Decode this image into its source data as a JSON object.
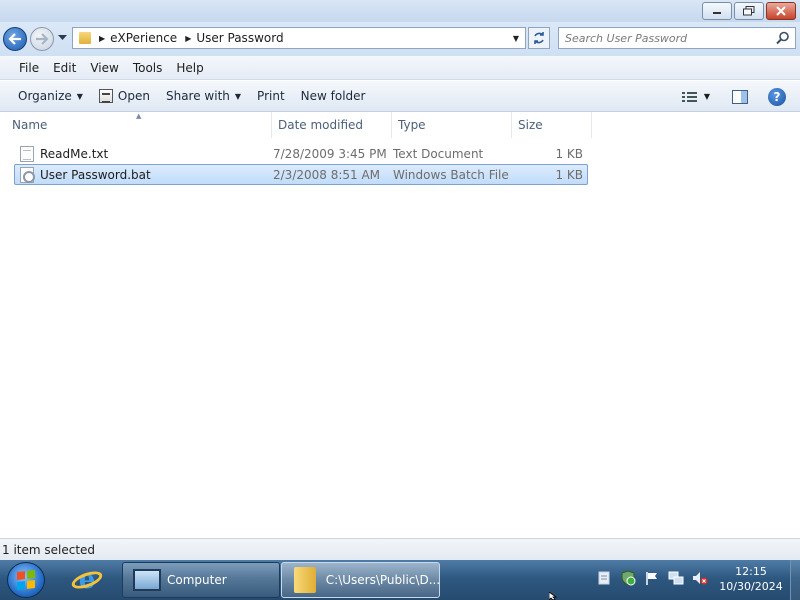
{
  "window": {
    "buttons": {
      "minimize": "minimize",
      "maximize": "maximize",
      "close": "close"
    }
  },
  "address": {
    "crumbs": [
      "eXPerience",
      "User Password"
    ],
    "search_placeholder": "Search User Password"
  },
  "menu": [
    "File",
    "Edit",
    "View",
    "Tools",
    "Help"
  ],
  "toolbar": {
    "organize": "Organize",
    "open": "Open",
    "share_with": "Share with",
    "print": "Print",
    "new_folder": "New folder"
  },
  "columns": {
    "name": "Name",
    "date_modified": "Date modified",
    "type": "Type",
    "size": "Size"
  },
  "files": [
    {
      "name": "ReadMe.txt",
      "date": "7/28/2009 3:45 PM",
      "type": "Text Document",
      "size": "1 KB",
      "icon": "text-file-icon"
    },
    {
      "name": "User Password.bat",
      "date": "2/3/2008 8:51 AM",
      "type": "Windows Batch File",
      "size": "1 KB",
      "icon": "batch-file-icon",
      "selected": true
    }
  ],
  "status": {
    "text": "1 item selected"
  },
  "taskbar": {
    "computer": "Computer",
    "explorer": "C:\\Users\\Public\\D...",
    "time": "12:15",
    "date": "10/30/2024"
  },
  "colors": {
    "accent": "#1c5bb0",
    "selection": "#c1dcfb",
    "taskbar": "#2e5880"
  }
}
